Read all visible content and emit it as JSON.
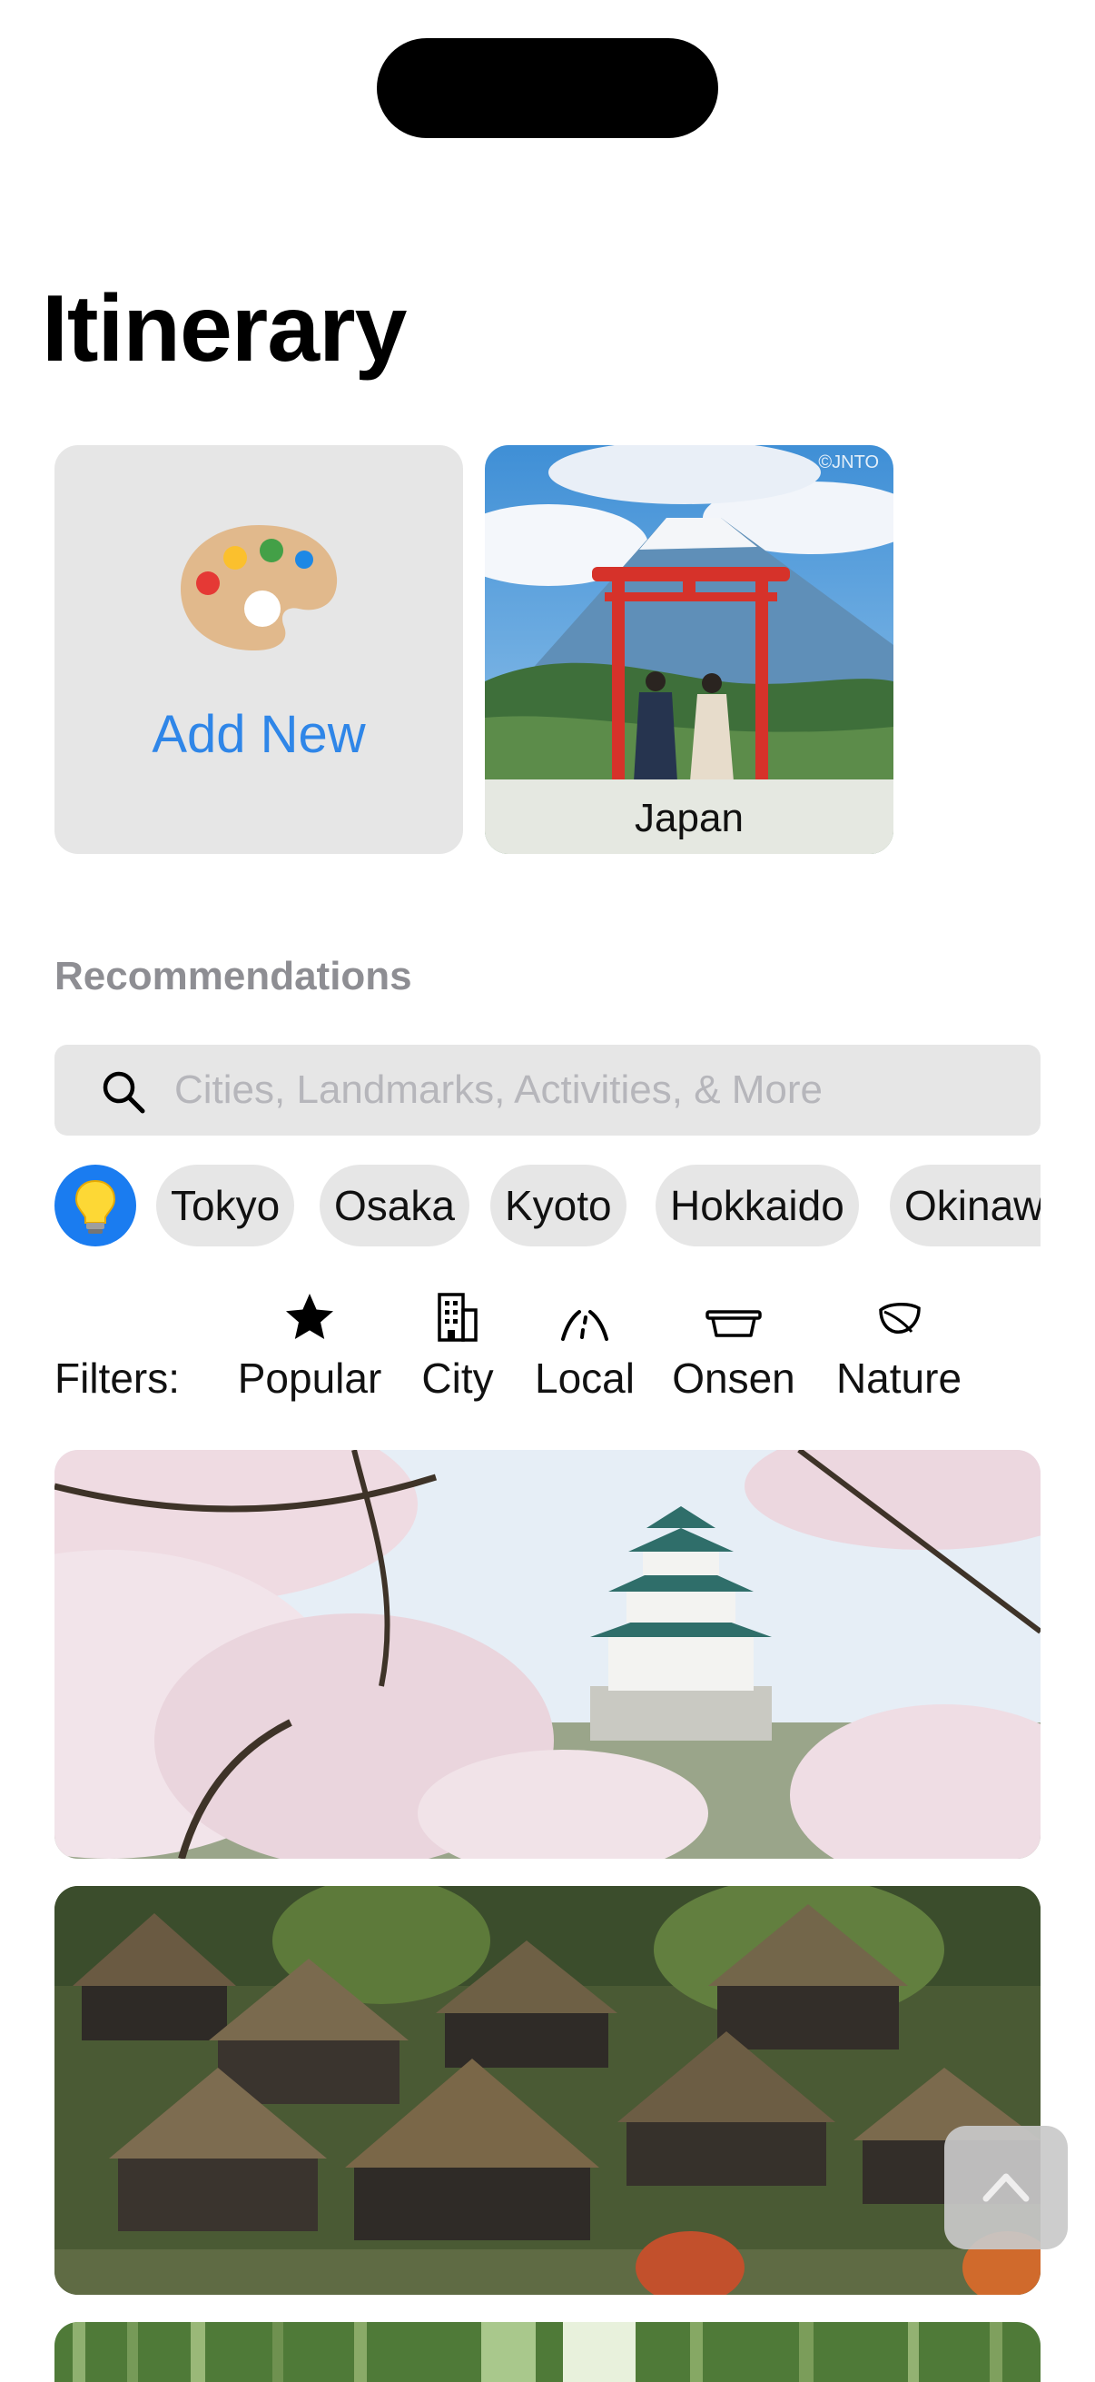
{
  "header": {
    "title": "Itinerary"
  },
  "itinerary": {
    "add_label": "Add New",
    "trips": [
      {
        "name": "Japan",
        "credit": "©JNTO"
      }
    ]
  },
  "recommendations": {
    "heading": "Recommendations",
    "search": {
      "placeholder": "Cities, Landmarks, Activities, & More"
    },
    "suggest_icon": "lightbulb-icon",
    "cities": [
      "Tokyo",
      "Osaka",
      "Kyoto",
      "Hokkaido",
      "Okinawa"
    ],
    "filters_label": "Filters:",
    "filters": [
      {
        "label": "Popular",
        "icon": "star-icon"
      },
      {
        "label": "City",
        "icon": "building-icon"
      },
      {
        "label": "Local",
        "icon": "road-icon"
      },
      {
        "label": "Onsen",
        "icon": "bathtub-icon"
      },
      {
        "label": "Nature",
        "icon": "leaf-icon"
      }
    ]
  },
  "colors": {
    "accent": "#2f86e8",
    "chip_bg": "#e6e6e6",
    "bulb_bg": "#1a7cf0",
    "secondary_text": "#8e8e93"
  }
}
